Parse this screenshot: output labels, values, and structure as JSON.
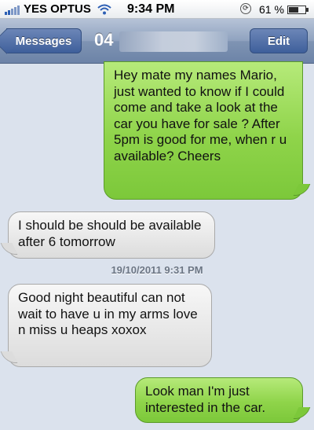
{
  "status_bar": {
    "carrier": "YES OPTUS",
    "time": "9:34 PM",
    "battery_percent": "61 %",
    "battery_level": 0.61,
    "icons": [
      "signal-bars-icon",
      "wifi-icon",
      "rotation-lock-icon",
      "battery-icon"
    ]
  },
  "nav": {
    "back_label": "Messages",
    "title": "04",
    "edit_label": "Edit"
  },
  "messages": [
    {
      "direction": "sent",
      "text": "Hey mate my names Mario, just wanted to know if I could come and take a look at the car you have for sale ? After 5pm is good for me, when r u available? Cheers"
    },
    {
      "direction": "received",
      "text": "I should be should be available after 6 tomorrow"
    },
    {
      "direction": "received",
      "text": "Good night beautiful can not wait to have u in my arms love n miss u heaps xoxox"
    },
    {
      "direction": "sent",
      "text": "Look man I'm just interested in the car."
    }
  ],
  "timestamp": "19/10/2011 9:31 PM",
  "colors": {
    "background": "#dbe2ed",
    "sent_bubble": "#8fd44a",
    "received_bubble": "#e6e6e6",
    "nav_bar": "#7f94b3",
    "nav_button": "#4d6ca6"
  }
}
